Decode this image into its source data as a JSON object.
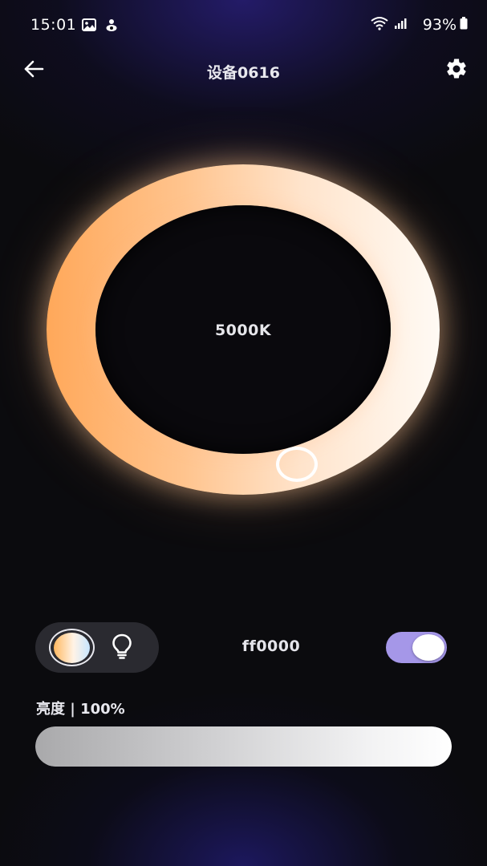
{
  "status_bar": {
    "time": "15:01",
    "battery_percent": "93%",
    "left_icons": [
      "gallery-icon",
      "notification-icon"
    ],
    "right_icons": [
      "wifi-icon",
      "signal-icon",
      "battery-icon"
    ]
  },
  "header": {
    "title": "设备0616",
    "back_icon": "arrow-left-icon",
    "settings_icon": "gear-icon"
  },
  "color_temperature": {
    "value_label": "5000K"
  },
  "controls": {
    "modes": [
      {
        "name": "color-temperature-mode",
        "icon": "cct-circle-icon",
        "selected": true
      },
      {
        "name": "bulb-mode",
        "icon": "bulb-icon",
        "selected": false
      }
    ],
    "color_code": "ff0000",
    "power_on": true
  },
  "brightness": {
    "label": "亮度 | 100%",
    "value": 1.0
  },
  "colors": {
    "accent_toggle": "#a597e8",
    "ring_warm": "#ffa85a",
    "ring_cool": "#fffaf4",
    "background": "#0b0b0e"
  }
}
